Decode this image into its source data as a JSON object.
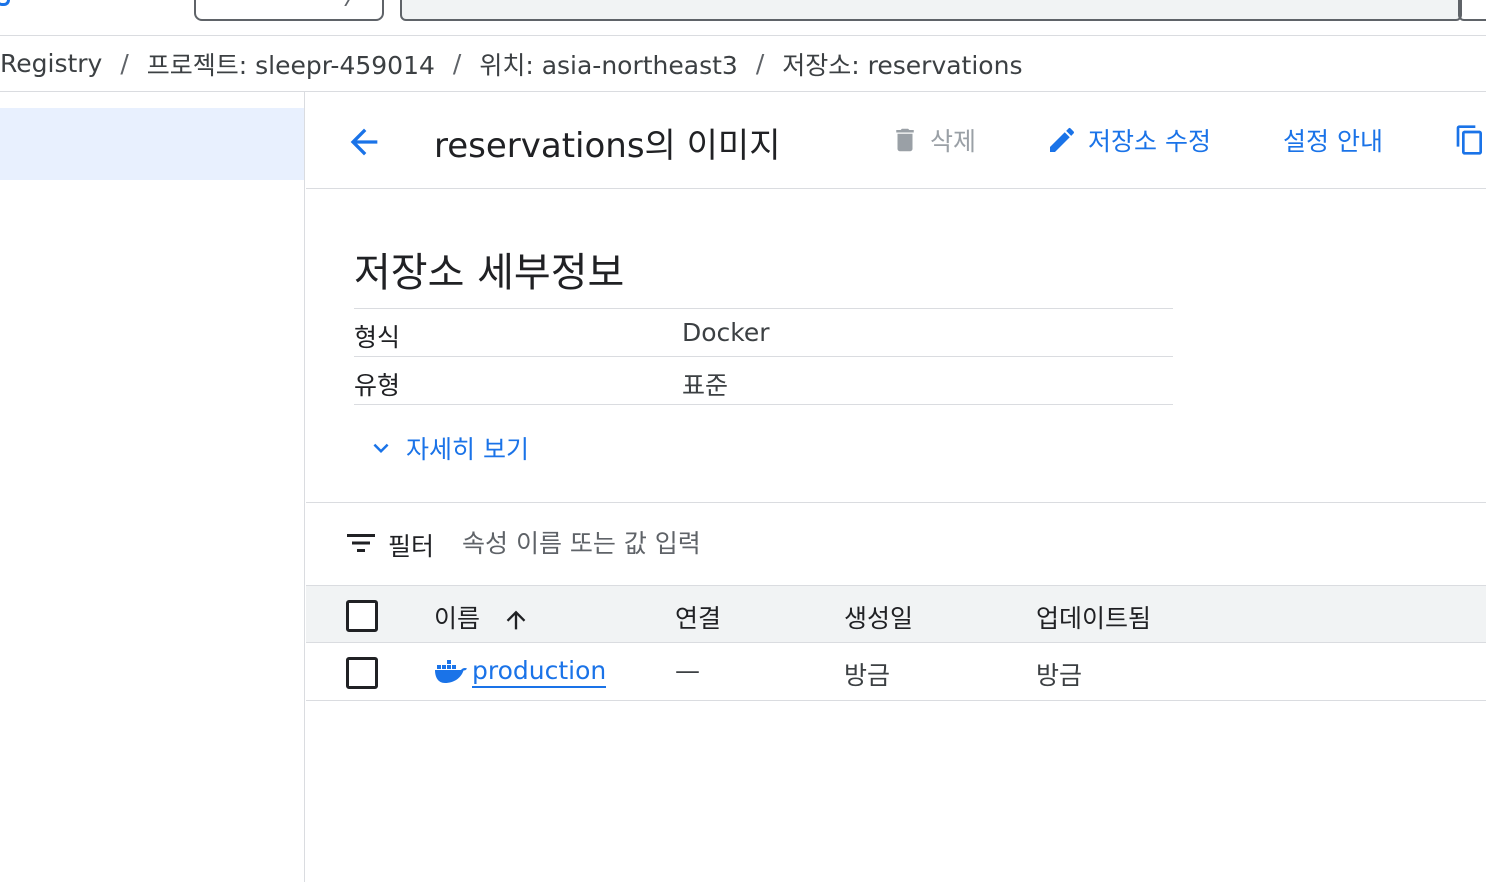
{
  "breadcrumb": {
    "items": [
      "Registry",
      "프로젝트: sleepr-459014",
      "위치: asia-northeast3",
      "저장소: reservations"
    ]
  },
  "toolbar": {
    "title": "reservations의 이미지",
    "delete_label": "삭제",
    "edit_label": "저장소 수정",
    "setup_label": "설정 안내"
  },
  "details": {
    "title": "저장소 세부정보",
    "rows": [
      {
        "key": "형식",
        "value": "Docker"
      },
      {
        "key": "유형",
        "value": "표준"
      }
    ],
    "more_label": "자세히 보기"
  },
  "filter": {
    "label": "필터",
    "placeholder": "속성 이름 또는 값 입력"
  },
  "table": {
    "headers": {
      "name": "이름",
      "link": "연결",
      "created": "생성일",
      "updated": "업데이트됨"
    },
    "rows": [
      {
        "name": "production",
        "link": "—",
        "created": "방금",
        "updated": "방금"
      }
    ]
  },
  "colors": {
    "accent": "#1a73e8",
    "selected_nav_bg": "#e8f0fe",
    "header_bg": "#f1f3f4",
    "disabled": "#9aa0a6"
  },
  "icons": [
    "back-arrow-icon",
    "trash-icon",
    "pencil-icon",
    "copy-icon",
    "chevron-down-icon",
    "filter-icon",
    "arrow-up-icon",
    "docker-icon"
  ]
}
